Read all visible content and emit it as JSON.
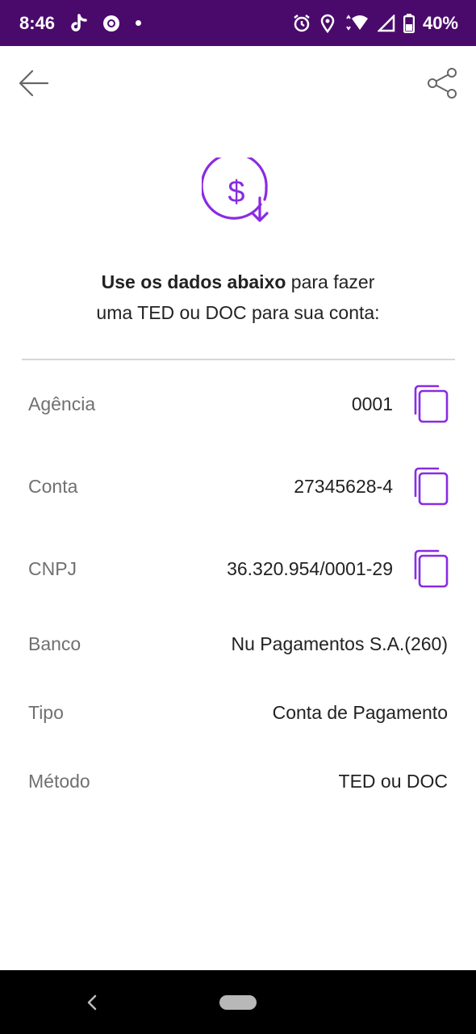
{
  "status_bar": {
    "time": "8:46",
    "battery": "40%",
    "left_icons": [
      "tiktok-icon",
      "chrome-icon",
      "dot-icon"
    ],
    "right_icons": [
      "alarm-icon",
      "location-icon",
      "wifi-icon",
      "signal-icon",
      "battery-icon"
    ]
  },
  "header": {
    "back_icon": "arrow-left-icon",
    "share_icon": "share-icon"
  },
  "hero_icon": "dollar-receive-icon",
  "intro": {
    "bold": "Use os dados abaixo",
    "rest_line1": " para fazer",
    "line2": "uma TED ou DOC para sua conta:"
  },
  "rows": [
    {
      "label": "Agência",
      "value": "0001",
      "copy": true
    },
    {
      "label": "Conta",
      "value": "27345628-4",
      "copy": true
    },
    {
      "label": "CNPJ",
      "value": "36.320.954/0001-29",
      "copy": true
    },
    {
      "label": "Banco",
      "value": "Nu Pagamentos S.A.(260)",
      "copy": false
    },
    {
      "label": "Tipo",
      "value": "Conta de Pagamento",
      "copy": false
    },
    {
      "label": "Método",
      "value": "TED ou DOC",
      "copy": false
    }
  ],
  "colors": {
    "status_bar": "#4a0a6b",
    "accent": "#8a2be2",
    "label": "#707070",
    "text": "#222222"
  }
}
